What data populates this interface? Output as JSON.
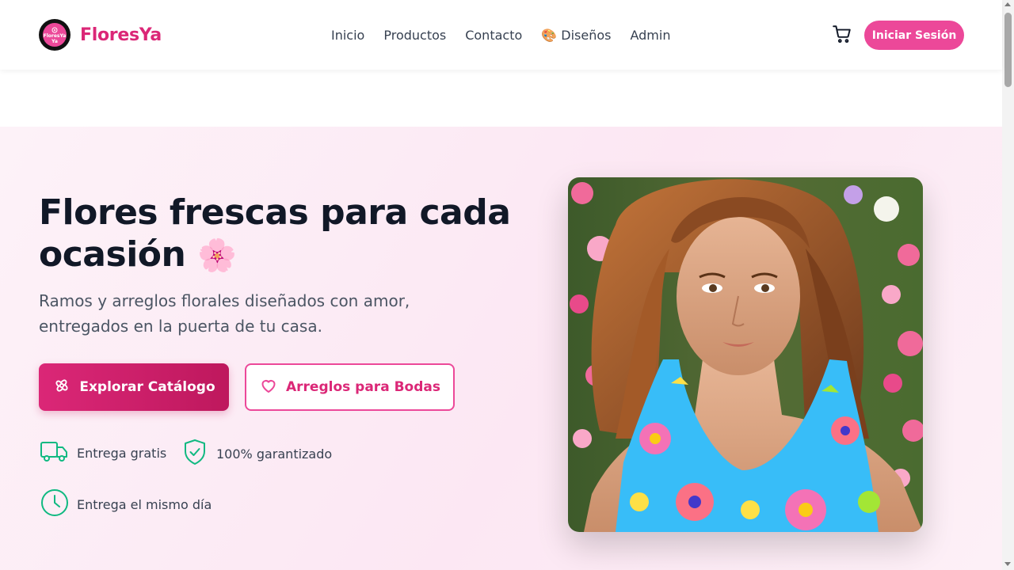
{
  "brand": {
    "name": "FloresYa",
    "logo_text": "FloresYa",
    "color": "#db2777"
  },
  "nav": {
    "items": [
      {
        "label": "Inicio"
      },
      {
        "label": "Productos"
      },
      {
        "label": "Contacto"
      },
      {
        "label": "🎨 Diseños"
      },
      {
        "label": "Admin"
      }
    ]
  },
  "header": {
    "cart_icon": "cart-icon",
    "login_label": "Iniciar Sesión"
  },
  "hero": {
    "title": "Flores frescas para cada ocasión",
    "title_emoji": "🌸",
    "subtitle": "Ramos y arreglos florales diseñados con amor, entregados en la puerta de tu casa.",
    "primary_cta": {
      "label": "Explorar Catálogo",
      "icon": "flower-icon"
    },
    "secondary_cta": {
      "label": "Arreglos para Bodas",
      "icon": "heart-icon"
    },
    "features": [
      {
        "label": "Entrega gratis",
        "icon": "truck-icon"
      },
      {
        "label": "100% garantizado",
        "icon": "shield-check-icon"
      },
      {
        "label": "Entrega el mismo día",
        "icon": "clock-icon"
      }
    ],
    "image": {
      "subject": "woman-in-floral-dress-with-flowers"
    }
  },
  "colors": {
    "accent": "#ec4899",
    "accent_dark": "#be185d",
    "feature_icon": "#10b981",
    "hero_bg": "#fce7f3"
  }
}
